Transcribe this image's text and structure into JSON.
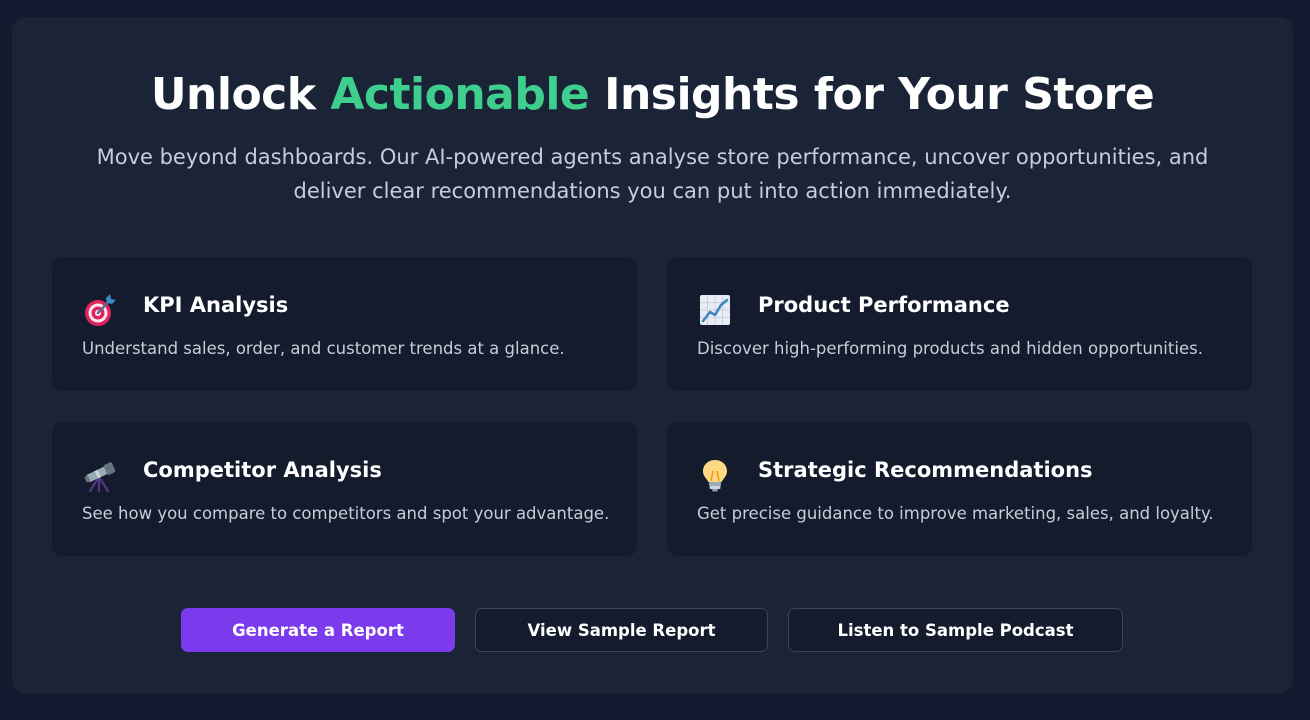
{
  "hero": {
    "title_before": "Unlock ",
    "title_accent": "Actionable",
    "title_after": " Insights for Your Store",
    "subtitle_line1": "Move beyond dashboards. Our AI-powered agents analyse store performance, uncover opportunities, and",
    "subtitle_line2": "deliver clear recommendations you can put into action immediately."
  },
  "features": [
    {
      "title": "KPI Analysis",
      "description": "Understand sales, order, and customer trends at a glance.",
      "icon": "target-icon"
    },
    {
      "title": "Product Performance",
      "description": "Discover high-performing products and hidden opportunities.",
      "icon": "chart-increasing-icon"
    },
    {
      "title": "Competitor Analysis",
      "description": "See how you compare to competitors and spot your advantage.",
      "icon": "telescope-icon"
    },
    {
      "title": "Strategic Recommendations",
      "description": "Get precise guidance to improve marketing, sales, and loyalty.",
      "icon": "light-bulb-icon"
    }
  ],
  "actions": {
    "generate_label": "Generate a Report",
    "view_sample_label": "View Sample Report",
    "listen_sample_label": "Listen to Sample Podcast"
  },
  "colors": {
    "page_background": "#111a2e",
    "panel_background": "#1b2437",
    "card_background": "#131b2d",
    "accent_green": "#3ecf8e",
    "primary_purple": "#7c3aed",
    "text_primary": "#ffffff",
    "text_secondary": "#c7ccd8"
  }
}
